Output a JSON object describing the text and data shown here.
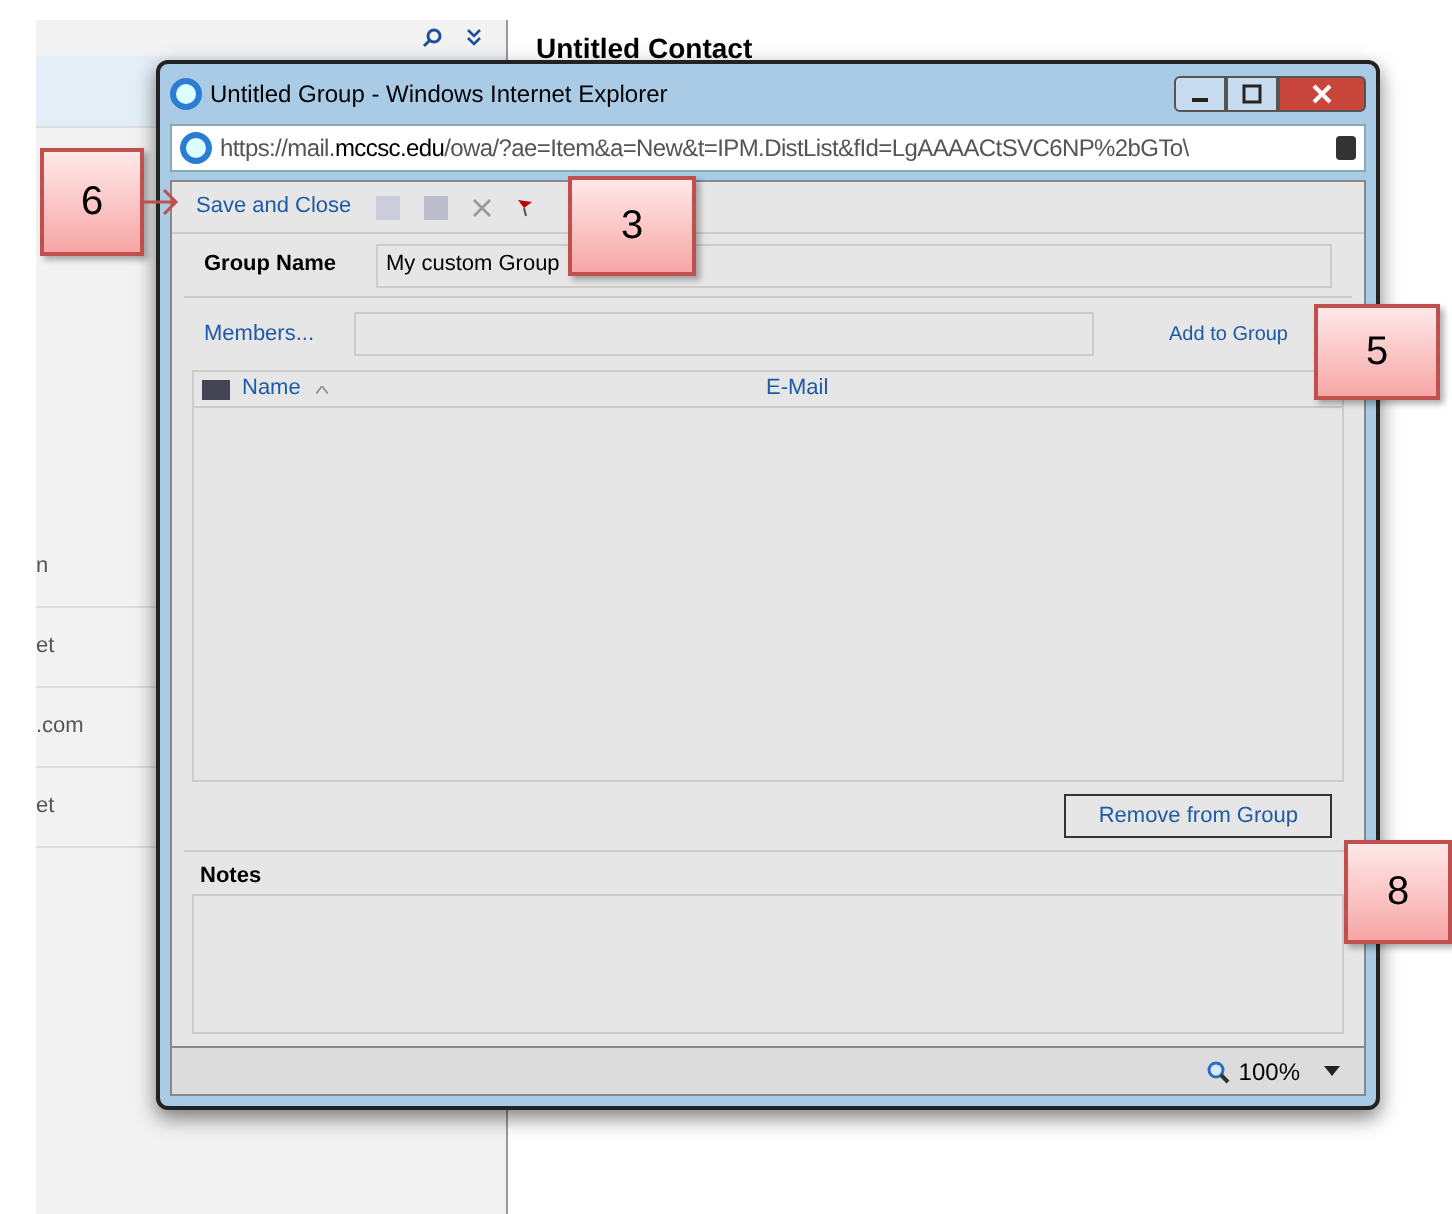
{
  "background": {
    "window_title": "Untitled Contact",
    "list_items": [
      "n",
      "et",
      ".com",
      "et"
    ]
  },
  "window": {
    "title": "Untitled Group - Windows Internet Explorer",
    "address": {
      "scheme": "https://",
      "sub": "mail.",
      "domain": "mccsc.edu",
      "path": "/owa/?ae=Item&a=New&t=IPM.DistList&fId=LgAAAACtSVC6NP%2bGTo\\"
    }
  },
  "toolbar": {
    "save": "Save and Close"
  },
  "form": {
    "group_name_label": "Group Name",
    "group_name_value": "My custom Group",
    "members_link": "Members...",
    "add_link": "Add to Group",
    "columns": [
      "Name",
      "E-Mail"
    ],
    "remove_button": "Remove from Group",
    "notes_label": "Notes"
  },
  "status_bar": {
    "zoom": "100%"
  },
  "callouts": [
    {
      "label": "6",
      "kind": "arrow"
    },
    {
      "label": "3",
      "kind": "plain"
    },
    {
      "label": "5",
      "kind": "plain"
    },
    {
      "label": "8",
      "kind": "plain"
    }
  ]
}
